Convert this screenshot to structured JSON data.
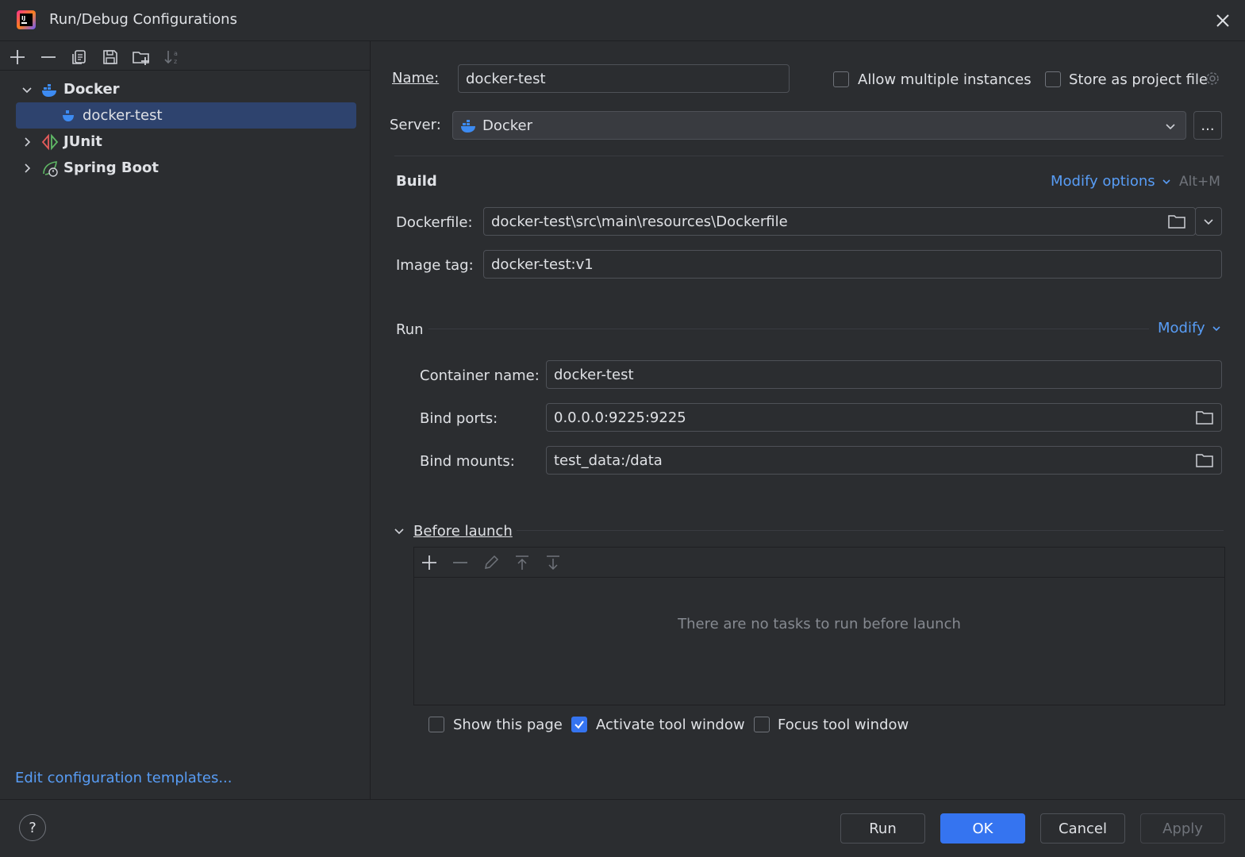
{
  "window": {
    "title": "Run/Debug Configurations"
  },
  "sidebar": {
    "tree": [
      {
        "label": "Docker",
        "icon": "docker-icon",
        "expanded": true
      },
      {
        "label": "docker-test",
        "icon": "docker-icon",
        "selected": true
      },
      {
        "label": "JUnit",
        "icon": "junit-icon",
        "expanded": false
      },
      {
        "label": "Spring Boot",
        "icon": "spring-boot-icon",
        "expanded": false
      }
    ],
    "edit_templates_link": "Edit configuration templates..."
  },
  "form": {
    "name_label": "Name:",
    "name_value": "docker-test",
    "allow_multiple_label": "Allow multiple instances",
    "store_project_label": "Store as project file",
    "server_label": "Server:",
    "server_value": "Docker",
    "server_more": "...",
    "build": {
      "title": "Build",
      "modify_options": "Modify options",
      "shortcut": "Alt+M",
      "dockerfile_label": "Dockerfile:",
      "dockerfile_value": "docker-test\\src\\main\\resources\\Dockerfile",
      "image_tag_label": "Image tag:",
      "image_tag_value": "docker-test:v1"
    },
    "run": {
      "title": "Run",
      "modify": "Modify",
      "container_name_label": "Container name:",
      "container_name_value": "docker-test",
      "bind_ports_label": "Bind ports:",
      "bind_ports_value": "0.0.0.0:9225:9225",
      "bind_mounts_label": "Bind mounts:",
      "bind_mounts_value": "test_data:/data"
    },
    "before_launch": {
      "title": "Before launch",
      "empty_text": "There are no tasks to run before launch",
      "show_page_label": "Show this page",
      "activate_tool_label": "Activate tool window",
      "focus_tool_label": "Focus tool window"
    }
  },
  "footer": {
    "help": "?",
    "run": "Run",
    "ok": "OK",
    "cancel": "Cancel",
    "apply": "Apply"
  },
  "colors": {
    "background": "#2b2d30",
    "accent": "#3574f0",
    "link": "#589df6",
    "selection": "#2e436e"
  }
}
